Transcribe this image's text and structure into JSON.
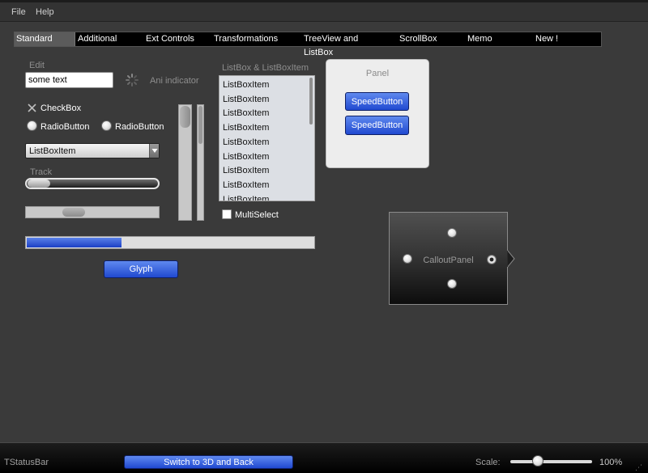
{
  "menu": {
    "file": "File",
    "help": "Help"
  },
  "tabs": [
    {
      "label": "Standard",
      "active": true
    },
    {
      "label": "Additional"
    },
    {
      "label": "Ext Controls"
    },
    {
      "label": "Transformations"
    },
    {
      "label": "TreeView and ListBox"
    },
    {
      "label": "ScrollBox"
    },
    {
      "label": "Memo"
    },
    {
      "label": "New !"
    }
  ],
  "standard": {
    "edit_label": "Edit",
    "edit_value": "some text",
    "ani_indicator": "Ani indicator",
    "checkbox_label": "CheckBox",
    "checkbox_checked": true,
    "radio1_label": "RadioButton",
    "radio2_label": "RadioButton",
    "combo_value": "ListBoxItem",
    "track_label": "Track",
    "track_value": 0.0,
    "progress_value": 0.33,
    "glyph_label": "Glyph"
  },
  "listbox": {
    "title": "ListBox & ListBoxItem",
    "items": [
      "ListBoxItem",
      "ListBoxItem",
      "ListBoxItem",
      "ListBoxItem",
      "ListBoxItem",
      "ListBoxItem",
      "ListBoxItem",
      "ListBoxItem",
      "ListBoxItem"
    ],
    "multiselect_label": "MultiSelect",
    "multiselect_checked": false
  },
  "panel": {
    "title": "Panel",
    "speed1": "SpeedButton",
    "speed2": "SpeedButton"
  },
  "callout": {
    "title": "CalloutPanel"
  },
  "statusbar": {
    "label": "TStatusBar",
    "switch_button": "Switch to 3D and Back",
    "scale_label": "Scale:",
    "scale_value": "100%"
  },
  "colors": {
    "accent": "#2e5ad8",
    "background": "#3a3a3a"
  }
}
